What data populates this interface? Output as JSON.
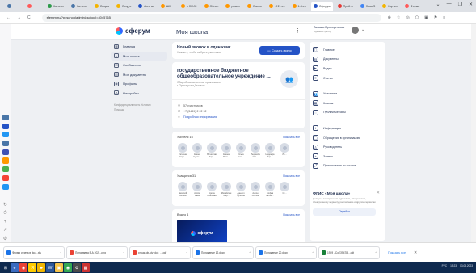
{
  "browser": {
    "tabs": [
      {
        "label": "",
        "color": "#4a76a8"
      },
      {
        "label": "",
        "color": "#ff5a5a"
      },
      {
        "label": "Каталог",
        "color": "#2d9a4b"
      },
      {
        "label": "Каталог",
        "color": "#4a76a8"
      },
      {
        "label": "Вход в",
        "color": "#f4b400"
      },
      {
        "label": "Вход в",
        "color": "#f4b400"
      },
      {
        "label": "Лого ш",
        "color": "#2453c6"
      },
      {
        "label": "Ш0",
        "color": "#ff9800"
      },
      {
        "label": "в ФГИС",
        "color": "#ff9800"
      },
      {
        "label": "Обнар",
        "color": "#ff9800"
      },
      {
        "label": "решен",
        "color": "#ff9800"
      },
      {
        "label": "Бэклог",
        "color": "#ff9800"
      },
      {
        "label": "ОФ-тех",
        "color": "#ff9800"
      },
      {
        "label": "1-8-ен",
        "color": "#ff9800"
      },
      {
        "label": "Сферум",
        "color": "#2453c6",
        "active": true
      },
      {
        "label": "Пройти",
        "color": "#e53935"
      },
      {
        "label": "Заяв S",
        "color": "#4285f4"
      },
      {
        "label": "Картин",
        "color": "#f4b400"
      },
      {
        "label": "Форма",
        "color": "#ff5a5a"
      }
    ],
    "window_controls": [
      "⌄",
      "—",
      "❐",
      "✕"
    ],
    "url": "sferum.ru/?p=schooladmin&school=4045765",
    "nav": [
      "←",
      "→",
      "C",
      "⌂"
    ],
    "addr_icons": [
      "⊕",
      "☆",
      "◎",
      "⬡",
      "▣",
      "⚑",
      "≡"
    ]
  },
  "vk_sidebar": {
    "icons": [
      {
        "name": "vk-app-1",
        "color": "#4a76a8"
      },
      {
        "name": "vk-app-2",
        "color": "#2453c6"
      },
      {
        "name": "vk-app-3",
        "color": "#2196f3"
      },
      {
        "name": "vk-app-4",
        "color": "#4a76a8"
      },
      {
        "name": "vk-app-5",
        "color": "#3f51b5"
      },
      {
        "name": "vk-app-6",
        "color": "#ff9800"
      },
      {
        "name": "vk-app-7",
        "color": "#4caf50"
      },
      {
        "name": "vk-app-8",
        "color": "#f44336"
      },
      {
        "name": "vk-app-9",
        "color": "#2196f3"
      }
    ],
    "bottom_icons": [
      "↻",
      "⏱",
      "+",
      "↗",
      "⚙"
    ]
  },
  "header": {
    "logo_text": "сферум",
    "school_title": "Моя школа",
    "kebab": "⋮",
    "user_name": "Татьяна Прохоренкова",
    "user_role": "Администратор",
    "chevron": "⌄"
  },
  "left_nav": {
    "items": [
      {
        "label": "Главная",
        "icon": "▦",
        "name": "home",
        "active": false
      },
      {
        "label": "Моя школа",
        "icon": "⌂",
        "name": "my-school",
        "active": true
      },
      {
        "label": "Сообщения",
        "icon": "✉",
        "name": "messages",
        "active": false
      },
      {
        "label": "Мои документы",
        "icon": "▤",
        "name": "documents",
        "active": false
      },
      {
        "label": "Профиль",
        "icon": "◉",
        "name": "profile",
        "active": false
      },
      {
        "label": "Настройки",
        "icon": "⚙",
        "name": "settings",
        "active": false
      }
    ],
    "footer_1": "Конфиденциальность   Условия",
    "footer_2": "Помощь"
  },
  "call_card": {
    "title": "Новый звонок в один клик",
    "subtitle": "Нажмите, чтобы выбрать участников",
    "button": "Создать звонок"
  },
  "org_card": {
    "name_line1": "государственное бюджетное",
    "name_line2": "общеобразовательное учреждение ...",
    "type_line1": "Общеобразовательная организация",
    "type_line2": "г. Приозерск и Джанкой",
    "icon": "👥",
    "participants": "57 участников",
    "phone": "+7 (3439) 2 22 92",
    "details": "Подробная информация"
  },
  "teachers": {
    "header": "Учителя 16",
    "show_all": "Показать все",
    "people": [
      {
        "name": "Татьяна Стре..."
      },
      {
        "name": "Елена Чукае..."
      },
      {
        "name": "Вячеслав Кор..."
      },
      {
        "name": "Елена Пико..."
      },
      {
        "name": "Ольга Сем..."
      },
      {
        "name": "Людмила Оте..."
      },
      {
        "name": "Надежда Кор..."
      },
      {
        "name": "Ле..."
      }
    ]
  },
  "students": {
    "header": "Учащиеся 31",
    "show_all": "Показать все",
    "people": [
      {
        "name": "Василий Репина"
      },
      {
        "name": "Артём Баев"
      },
      {
        "name": "Арина Нейшава"
      },
      {
        "name": "Михайлем Мар..."
      },
      {
        "name": "Даниил Пузиков"
      },
      {
        "name": "Антон Хохлов"
      },
      {
        "name": "Софья Галки..."
      },
      {
        "name": "Ст..."
      }
    ]
  },
  "video_card": {
    "header": "Видео 4",
    "show_all": "Показать все",
    "thumb_text": "сферум"
  },
  "right_menu": {
    "group1": [
      {
        "label": "Главное",
        "icon": "▢",
        "name": "main"
      },
      {
        "label": "Документы",
        "icon": "▤",
        "name": "docs"
      },
      {
        "label": "Видео",
        "icon": "▶",
        "name": "video"
      },
      {
        "label": "Статьи",
        "icon": "≡",
        "name": "articles"
      }
    ],
    "group2": [
      {
        "label": "Участники",
        "icon": "👥",
        "name": "members"
      },
      {
        "label": "Классы",
        "icon": "▦",
        "name": "classes"
      },
      {
        "label": "Публичные чаты",
        "icon": "◌",
        "name": "public-chats"
      }
    ],
    "group3": [
      {
        "label": "Информация",
        "icon": "i",
        "name": "info"
      },
      {
        "label": "Обращения в организацию",
        "icon": "◯",
        "name": "appeals"
      },
      {
        "label": "Руководитель",
        "icon": "♙",
        "name": "head"
      },
      {
        "label": "Заявки",
        "icon": "+",
        "name": "requests"
      },
      {
        "label": "Приглашения по ссылке",
        "icon": "⤴",
        "name": "invites"
      }
    ]
  },
  "promo": {
    "title": "ФГИС «Моя школа»",
    "desc": "Доступ к электронным журналам, материалам, электронному журналу, расписанию и другим сервисам",
    "button": "Перейти",
    "close": "✕"
  },
  "downloads": {
    "items": [
      {
        "label": "Форма отчета в фо....xls",
        "type": "blue"
      },
      {
        "label": "Пономаева Е.А 202....png",
        "type": "red"
      },
      {
        "label": "prikaz-ob-utv_dok_....pdf",
        "type": "red"
      },
      {
        "label": "Положение 12.docx",
        "type": "blue"
      },
      {
        "label": "Положение 20.docx",
        "type": "blue"
      },
      {
        "label": "1939 - СоЕЗ5478....odt",
        "type": "grn"
      }
    ],
    "show_all": "Показать все",
    "close": "✕"
  },
  "taskbar": {
    "apps": [
      {
        "name": "start",
        "color": "#0f2a4f",
        "glyph": "⊞"
      },
      {
        "name": "edge",
        "color": "#3a6bbf",
        "glyph": "e"
      },
      {
        "name": "chrome",
        "color": "#e94235",
        "glyph": "◉"
      },
      {
        "name": "yandex",
        "color": "#ffcc00",
        "glyph": "Я"
      },
      {
        "name": "explorer",
        "color": "#f2b600",
        "glyph": "▰"
      },
      {
        "name": "word",
        "color": "#2b579a",
        "glyph": "W"
      },
      {
        "name": "folder",
        "color": "#f6c34a",
        "glyph": "▣"
      },
      {
        "name": "chrome2",
        "color": "#34a853",
        "glyph": "◉"
      },
      {
        "name": "settings",
        "color": "#4a4a4a",
        "glyph": "⚙"
      },
      {
        "name": "photos",
        "color": "#c33",
        "glyph": "▦"
      }
    ],
    "tray_text": "РУС",
    "time": "15:23",
    "date": "03.03.2023"
  }
}
